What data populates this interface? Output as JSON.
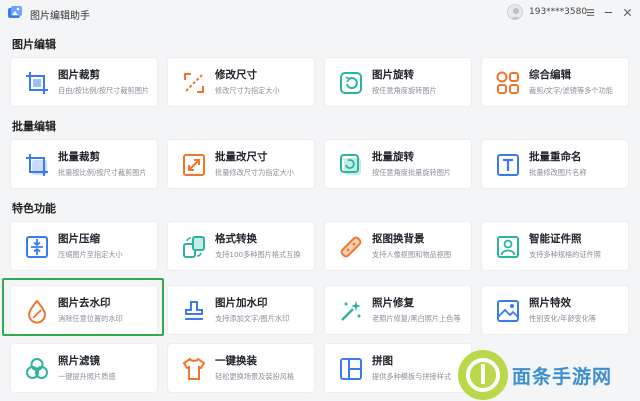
{
  "app": {
    "title": "图片编辑助手",
    "user": "193****3580"
  },
  "sections": [
    {
      "title": "图片编辑",
      "cards": [
        {
          "title": "图片裁剪",
          "desc": "自由/按比例/按尺寸裁剪图片",
          "icon": "crop-icon",
          "color": "#3a7bf0"
        },
        {
          "title": "修改尺寸",
          "desc": "修改尺寸为指定大小",
          "icon": "resize-icon",
          "color": "#f0762d"
        },
        {
          "title": "图片旋转",
          "desc": "按任意角度旋转图片",
          "icon": "rotate-icon",
          "color": "#2bb4a0"
        },
        {
          "title": "综合编辑",
          "desc": "裁剪/文字/滤镜等多个功能",
          "icon": "grid-icon",
          "color": "#f0762d"
        }
      ]
    },
    {
      "title": "批量编辑",
      "cards": [
        {
          "title": "批量裁剪",
          "desc": "批量按比例/按尺寸裁剪图片",
          "icon": "batch-crop-icon",
          "color": "#3a7bf0"
        },
        {
          "title": "批量改尺寸",
          "desc": "批量修改尺寸为指定大小",
          "icon": "batch-resize-icon",
          "color": "#f0762d"
        },
        {
          "title": "批量旋转",
          "desc": "按任意角度批量旋转图片",
          "icon": "batch-rotate-icon",
          "color": "#2bb4a0"
        },
        {
          "title": "批量重命名",
          "desc": "批量修改图片名称",
          "icon": "rename-icon",
          "color": "#3a7bf0"
        }
      ]
    },
    {
      "title": "特色功能",
      "cards": [
        {
          "title": "图片压缩",
          "desc": "压缩图片至指定大小",
          "icon": "compress-icon",
          "color": "#3a7bf0"
        },
        {
          "title": "格式转换",
          "desc": "支持100多种图片格式互换",
          "icon": "convert-icon",
          "color": "#2bb4a0"
        },
        {
          "title": "抠图换背景",
          "desc": "支持人像抠图和物品抠图",
          "icon": "cutout-icon",
          "color": "#f0762d"
        },
        {
          "title": "智能证件照",
          "desc": "支持多种规格的证件照",
          "icon": "id-photo-icon",
          "color": "#2bb4a0"
        },
        {
          "title": "图片去水印",
          "desc": "消除任意位置的水印",
          "icon": "remove-watermark-icon",
          "color": "#f0762d"
        },
        {
          "title": "图片加水印",
          "desc": "支持添加文字/图片水印",
          "icon": "add-watermark-icon",
          "color": "#3a7bf0"
        },
        {
          "title": "照片修复",
          "desc": "老照片修复/黑白照片上色等",
          "icon": "repair-icon",
          "color": "#2bb4a0"
        },
        {
          "title": "照片特效",
          "desc": "性别变化/年龄变化等",
          "icon": "effect-icon",
          "color": "#3a7bf0"
        },
        {
          "title": "照片滤镜",
          "desc": "一键提升照片质感",
          "icon": "filter-icon",
          "color": "#2bb4a0"
        },
        {
          "title": "一键换装",
          "desc": "轻松更换场景及装扮风格",
          "icon": "outfit-icon",
          "color": "#f0762d"
        },
        {
          "title": "拼图",
          "desc": "提供多种模板与拼接样式",
          "icon": "collage-icon",
          "color": "#3a7bf0"
        }
      ]
    }
  ],
  "watermark": {
    "text": "面条手游网"
  }
}
